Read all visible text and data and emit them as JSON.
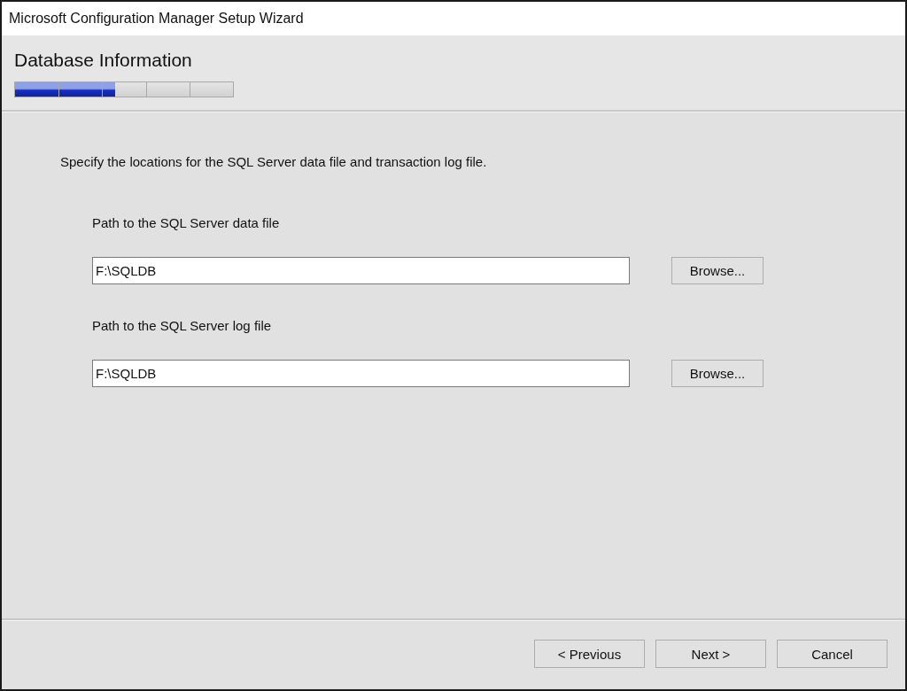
{
  "window": {
    "title": "Microsoft Configuration Manager Setup Wizard"
  },
  "header": {
    "title": "Database Information",
    "progress": {
      "level": 0.46
    }
  },
  "description": "Specify the locations for the SQL Server data file and transaction log file.",
  "fields": [
    {
      "label": "Path to the SQL Server data file",
      "value": "F:\\SQLDB",
      "button": "Browse..."
    },
    {
      "label": "Path to the SQL Server log file",
      "value": "F:\\SQLDB",
      "button": "Browse..."
    }
  ],
  "buttons": [
    "< Previous",
    "Next >",
    "Cancel"
  ]
}
